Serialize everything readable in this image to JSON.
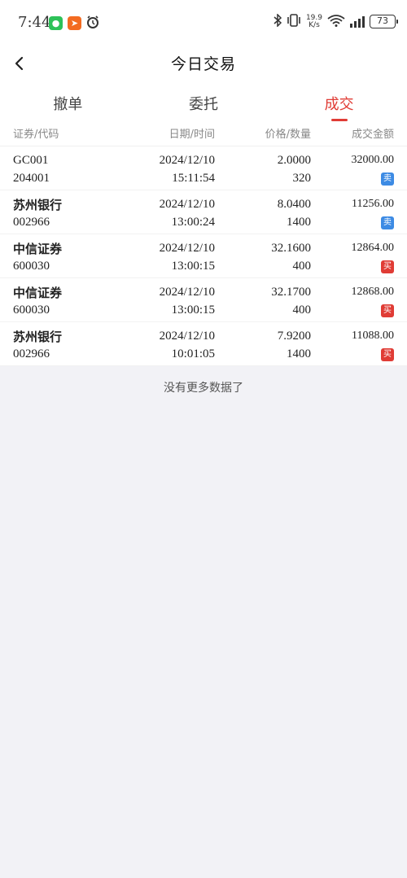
{
  "status": {
    "time": "7:44",
    "net_speed_value": "19.9",
    "net_speed_unit": "K/s",
    "battery": "73"
  },
  "header": {
    "title": "今日交易"
  },
  "tabs": [
    {
      "label": "撤单",
      "active": false
    },
    {
      "label": "委托",
      "active": false
    },
    {
      "label": "成交",
      "active": true
    }
  ],
  "columns": [
    "证券/代码",
    "日期/时间",
    "价格/数量",
    "成交金额"
  ],
  "rows": [
    {
      "name": "GC001",
      "code": "204001",
      "date": "2024/12/10",
      "time": "15:11:54",
      "price": "2.0000",
      "qty": "320",
      "amount": "32000.00",
      "side": "卖"
    },
    {
      "name": "苏州银行",
      "code": "002966",
      "date": "2024/12/10",
      "time": "13:00:24",
      "price": "8.0400",
      "qty": "1400",
      "amount": "11256.00",
      "side": "卖"
    },
    {
      "name": "中信证券",
      "code": "600030",
      "date": "2024/12/10",
      "time": "13:00:15",
      "price": "32.1600",
      "qty": "400",
      "amount": "12864.00",
      "side": "买"
    },
    {
      "name": "中信证券",
      "code": "600030",
      "date": "2024/12/10",
      "time": "13:00:15",
      "price": "32.1700",
      "qty": "400",
      "amount": "12868.00",
      "side": "买"
    },
    {
      "name": "苏州银行",
      "code": "002966",
      "date": "2024/12/10",
      "time": "10:01:05",
      "price": "7.9200",
      "qty": "1400",
      "amount": "11088.00",
      "side": "买"
    }
  ],
  "footer": {
    "text": "没有更多数据了"
  },
  "colors": {
    "accent": "#e03c35",
    "sell_badge": "#3d8be4",
    "buy_badge": "#e03c35"
  },
  "icons": {
    "back": "chevron-left-icon"
  }
}
